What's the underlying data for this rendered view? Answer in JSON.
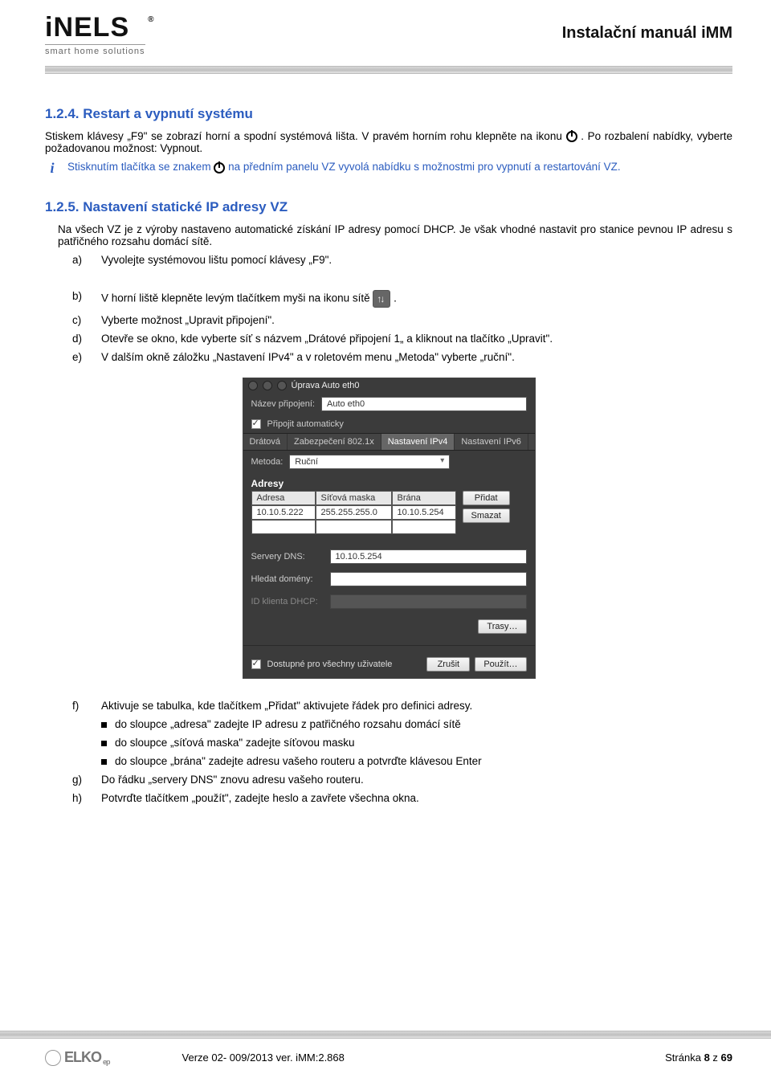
{
  "header": {
    "brand_main": "iNELS",
    "brand_sub": "smart home solutions",
    "doc_title": "Instalační manuál iMM"
  },
  "sec124": {
    "heading": "1.2.4. Restart a vypnutí systému",
    "p1a": "Stiskem klávesy „F9\" se zobrazí horní a spodní systémová lišta. V pravém horním rohu klepněte na ikonu ",
    "p1b": ". Po rozbalení nabídky, vyberte požadovanou možnost: Vypnout.",
    "info_a": "Stisknutím tlačítka se znakem ",
    "info_b": " na předním panelu VZ vyvolá nabídku s možnostmi pro vypnutí a restartování VZ."
  },
  "sec125": {
    "heading": "1.2.5. Nastavení statické IP adresy VZ",
    "intro": "Na všech VZ je z výroby nastaveno automatické získání IP adresy pomocí DHCP. Je však vhodné nastavit pro stanice pevnou IP adresu s patřičného rozsahu domácí sítě.",
    "a": "Vyvolejte systémovou lištu pomocí klávesy „F9\".",
    "b_a": "V horní liště klepněte levým tlačítkem myši na ikonu sítě ",
    "b_b": " .",
    "c": "Vyberte možnost „Upravit připojení\".",
    "d": "Otevře se okno, kde vyberte síť s názvem „Drátové připojení 1„ a kliknout na tlačítko „Upravit\".",
    "e": "V dalším okně  záložku „Nastavení IPv4\" a v roletovém menu „Metoda\" vyberte „ruční\".",
    "f": "Aktivuje se tabulka, kde tlačítkem „Přidat\" aktivujete řádek pro definici adresy.",
    "f1": "do sloupce „adresa\" zadejte IP adresu z patřičného rozsahu domácí sítě",
    "f2": "do sloupce „síťová maska\" zadejte síťovou masku",
    "f3": "do sloupce „brána\" zadejte adresu vašeho routeru a potvrďte klávesou Enter",
    "g": "Do řádku „servery DNS\" znovu adresu vašeho routeru.",
    "h": "Potvrďte tlačítkem „použít\", zadejte heslo a zavřete všechna okna."
  },
  "shot": {
    "title": "Úprava Auto eth0",
    "lbl_name": "Název připojení:",
    "val_name": "Auto eth0",
    "chk_auto": "Připojit automaticky",
    "tabs": [
      "Drátová",
      "Zabezpečení 802.1x",
      "Nastavení IPv4",
      "Nastavení IPv6"
    ],
    "lbl_method": "Metoda:",
    "val_method": "Ruční",
    "adr_header": "Adresy",
    "cols": [
      "Adresa",
      "Síťová maska",
      "Brána"
    ],
    "row": [
      "10.10.5.222",
      "255.255.255.0",
      "10.10.5.254"
    ],
    "btn_add": "Přidat",
    "btn_del": "Smazat",
    "lbl_dns": "Servery DNS:",
    "val_dns": "10.10.5.254",
    "lbl_search": "Hledat domény:",
    "lbl_dhcp": "ID klienta DHCP:",
    "btn_routes": "Trasy…",
    "chk_avail": "Dostupné pro všechny uživatele",
    "btn_cancel": "Zrušit",
    "btn_apply": "Použít…"
  },
  "footer": {
    "elko": "ELKO",
    "ep": "ep",
    "version": "Verze 02- 009/2013 ver. iMM:2.868",
    "page_a": "Stránka ",
    "page_b": "8",
    "page_c": " z ",
    "page_d": "69"
  }
}
